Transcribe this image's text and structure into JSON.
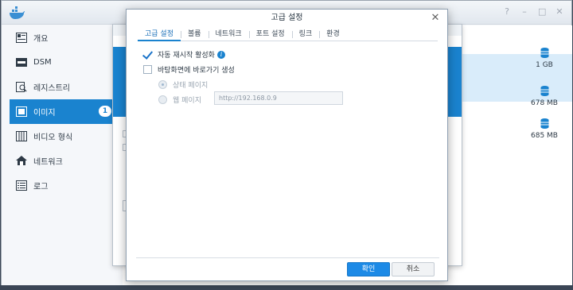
{
  "window": {
    "controls": [
      "?",
      "–",
      "□",
      "✕"
    ]
  },
  "sidebar": {
    "items": [
      {
        "label": "개요",
        "icon": "overview-icon"
      },
      {
        "label": "DSM",
        "icon": "dsm-icon"
      },
      {
        "label": "레지스트리",
        "icon": "registry-icon"
      },
      {
        "label": "이미지",
        "icon": "image-icon",
        "badge": "1",
        "active": true
      },
      {
        "label": "비디오 형식",
        "icon": "container-icon"
      },
      {
        "label": "네트워크",
        "icon": "network-icon"
      },
      {
        "label": "로그",
        "icon": "log-icon"
      }
    ]
  },
  "main": {
    "sizes": [
      "1 GB",
      "678 MB",
      "685 MB"
    ]
  },
  "dialog": {
    "title": "고급 설정",
    "tabs": [
      "고급 설정",
      "볼륨",
      "네트워크",
      "포트 설정",
      "링크",
      "환경"
    ],
    "auto_restart_label": "자동 재시작 활성화",
    "shortcut_label": "바탕화면에 바로가기 생성",
    "status_page_label": "상태 페이지",
    "web_page_label": "웹 페이지",
    "url_value": "http://192.168.0.9",
    "ok_label": "확인",
    "cancel_label": "취소"
  },
  "colors": {
    "accent": "#1a83cf",
    "sidebar_bg": "#f5f7fa"
  }
}
